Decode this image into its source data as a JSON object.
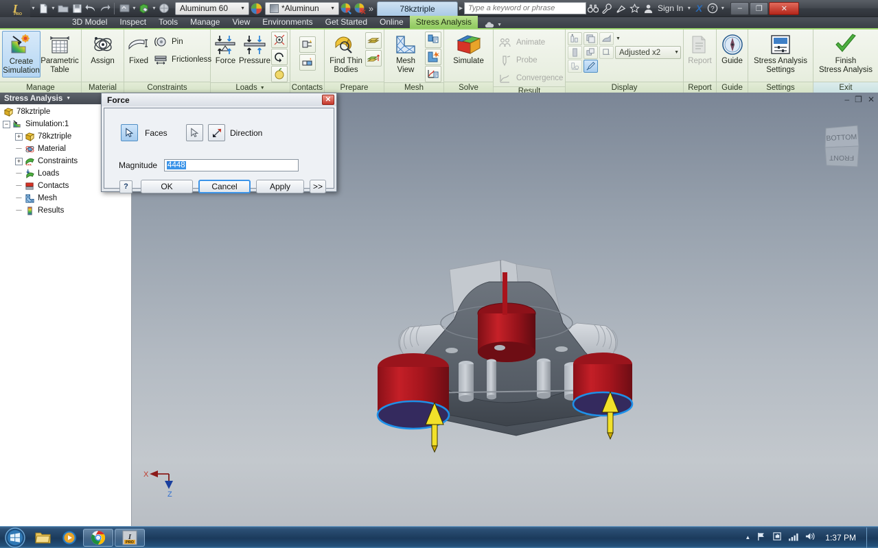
{
  "titlebar": {
    "app_logo": "inventor-logo",
    "pro_badge": "PRO",
    "quick_access": [
      {
        "name": "new-file",
        "icon": "document-icon"
      },
      {
        "name": "open-file",
        "icon": "folder-open-icon"
      },
      {
        "name": "save-file",
        "icon": "floppy-disk-icon"
      },
      {
        "name": "undo",
        "icon": "undo-arrow-icon"
      },
      {
        "name": "redo",
        "icon": "redo-arrow-icon"
      },
      {
        "name": "update",
        "icon": "update-icon"
      },
      {
        "name": "material-swatch",
        "icon": "material-box-icon"
      },
      {
        "name": "select-mode",
        "icon": "select-sphere-icon"
      }
    ],
    "material_combo": "Aluminum 60",
    "appearance_combo": "*Aluminun",
    "document_tab": "78kztriple",
    "search_placeholder": "Type a keyword or phrase",
    "search_value": "",
    "right_icons": [
      {
        "name": "binoculars-icon"
      },
      {
        "name": "wrench-icon"
      },
      {
        "name": "satellite-dish-icon"
      },
      {
        "name": "star-icon"
      }
    ],
    "sign_in": "Sign In",
    "exchange_icon": "autodesk-x-icon",
    "help_icon": "help-question-icon",
    "window_buttons": {
      "minimize": "–",
      "restore": "❐",
      "close": "✕"
    }
  },
  "ribbon_tabs": [
    {
      "label": "3D Model",
      "active": false
    },
    {
      "label": "Inspect",
      "active": false
    },
    {
      "label": "Tools",
      "active": false
    },
    {
      "label": "Manage",
      "active": false
    },
    {
      "label": "View",
      "active": false
    },
    {
      "label": "Environments",
      "active": false
    },
    {
      "label": "Get Started",
      "active": false
    },
    {
      "label": "Online",
      "active": false
    },
    {
      "label": "Stress Analysis",
      "active": true
    }
  ],
  "ribbon_tab_overflow": "cloud-dropdown-icon",
  "ribbon": {
    "panels": [
      {
        "title": "Manage",
        "buttons": [
          {
            "label": "Create\nSimulation",
            "icon": "create-simulation-icon",
            "selected": true
          },
          {
            "label": "Parametric\nTable",
            "icon": "parametric-table-icon",
            "selected": false
          }
        ]
      },
      {
        "title": "Material",
        "buttons": [
          {
            "label": "Assign",
            "icon": "assign-material-icon",
            "selected": false
          }
        ]
      },
      {
        "title": "Constraints",
        "buttons": [
          {
            "label": "Fixed",
            "icon": "fixed-constraint-icon",
            "selected": false
          }
        ],
        "small_items": [
          {
            "label": "Pin",
            "icon": "pin-constraint-icon"
          },
          {
            "label": "Frictionless",
            "icon": "frictionless-constraint-icon"
          }
        ]
      },
      {
        "title": "Loads",
        "has_dropdown": true,
        "buttons": [
          {
            "label": "Force",
            "icon": "force-load-icon",
            "selected": false
          },
          {
            "label": "Pressure",
            "icon": "pressure-load-icon",
            "selected": false
          }
        ],
        "icon_stack": [
          {
            "name": "bearing-load-icon"
          },
          {
            "name": "moment-load-icon"
          },
          {
            "name": "gravity-load-icon"
          }
        ]
      },
      {
        "title": "Contacts",
        "icon_stack": [
          {
            "name": "automatic-contacts-icon"
          },
          {
            "name": "manual-contact-icon"
          }
        ]
      },
      {
        "title": "Prepare",
        "buttons": [
          {
            "label": "Find Thin\nBodies",
            "icon": "find-thin-bodies-icon",
            "selected": false
          }
        ],
        "icon_stack": [
          {
            "name": "midsurface-icon"
          },
          {
            "name": "offset-surface-icon"
          }
        ]
      },
      {
        "title": "Mesh",
        "buttons": [
          {
            "label": "Mesh View",
            "icon": "mesh-view-icon",
            "selected": false
          }
        ],
        "icon_stack": [
          {
            "name": "mesh-settings-icon"
          },
          {
            "name": "local-mesh-control-icon"
          },
          {
            "name": "convergence-settings-icon"
          }
        ]
      },
      {
        "title": "Solve",
        "buttons": [
          {
            "label": "Simulate",
            "icon": "simulate-cube-icon",
            "selected": false
          }
        ]
      },
      {
        "title": "Result",
        "small_items": [
          {
            "label": "Animate",
            "icon": "animate-icon",
            "disabled": true
          },
          {
            "label": "Probe",
            "icon": "probe-icon",
            "disabled": true
          },
          {
            "label": "Convergence",
            "icon": "convergence-icon",
            "disabled": true
          }
        ]
      },
      {
        "title": "Display",
        "adjust_combo": "Adjusted x2",
        "icon_grid": [
          {
            "name": "max-min-values-icon",
            "selected": false
          },
          {
            "name": "boundary-conditions-icon",
            "selected": false
          },
          {
            "name": "shaded-contour-icon",
            "selected": false
          },
          {
            "name": "color-bar-icon",
            "selected": false
          },
          {
            "name": "probe-labels-icon",
            "selected": false
          },
          {
            "name": "display-mesh-icon",
            "selected": false
          },
          {
            "name": "reaction-force-icon",
            "selected": false
          },
          {
            "name": "brush-icon",
            "selected": true
          }
        ]
      },
      {
        "title": "Report",
        "buttons": [
          {
            "label": "Report",
            "icon": "report-icon",
            "disabled": true,
            "selected": false
          }
        ]
      },
      {
        "title": "Guide",
        "buttons": [
          {
            "label": "Guide",
            "icon": "compass-guide-icon",
            "selected": false
          }
        ]
      },
      {
        "title": "Settings",
        "buttons": [
          {
            "label": "Stress Analysis\nSettings",
            "icon": "stress-analysis-settings-icon",
            "selected": false
          }
        ]
      },
      {
        "title": "Exit",
        "buttons": [
          {
            "label": "Finish\nStress Analysis",
            "icon": "green-checkmark-icon",
            "selected": false
          }
        ]
      }
    ]
  },
  "browser": {
    "header": "Stress Analysis",
    "tree": [
      {
        "label": "78kztriple",
        "depth": 0,
        "icon": "part-cube-icon",
        "expander": "none",
        "line": false
      },
      {
        "label": "Simulation:1",
        "depth": 0,
        "icon": "simulation-icon",
        "expander": "minus",
        "line": false
      },
      {
        "label": "78kztriple",
        "depth": 1,
        "icon": "part-cube-icon",
        "expander": "plus",
        "line": false
      },
      {
        "label": "Material",
        "depth": 1,
        "icon": "material-icon",
        "expander": "none",
        "line": true
      },
      {
        "label": "Constraints",
        "depth": 1,
        "icon": "constraints-icon",
        "expander": "plus",
        "line": false
      },
      {
        "label": "Loads",
        "depth": 1,
        "icon": "loads-icon",
        "expander": "none",
        "line": true
      },
      {
        "label": "Contacts",
        "depth": 1,
        "icon": "contacts-icon",
        "expander": "none",
        "line": true
      },
      {
        "label": "Mesh",
        "depth": 1,
        "icon": "mesh-icon",
        "expander": "none",
        "line": true
      },
      {
        "label": "Results",
        "depth": 1,
        "icon": "results-icon",
        "expander": "none",
        "line": true
      }
    ]
  },
  "viewport": {
    "doc_window_buttons": {
      "minimize": "–",
      "restore": "❐",
      "close": "✕"
    },
    "viewcube": {
      "top_face": "BOTTOM",
      "front_face": "FRONT"
    },
    "axis_tripod": {
      "x_label": "X",
      "z_label": "Z"
    },
    "model_name": "78kztriple"
  },
  "force_dialog": {
    "title": "Force",
    "close_glyph": "✕",
    "faces_label": "Faces",
    "faces_button_icon": "cursor-select-icon",
    "direction_label": "Direction",
    "direction_pick_icon": "cursor-select-icon",
    "direction_flip_icon": "flip-direction-icon",
    "magnitude_label": "Magnitude",
    "magnitude_value": "4448",
    "help_glyph": "?",
    "buttons": {
      "ok": "OK",
      "cancel": "Cancel",
      "apply": "Apply",
      "more": ">>"
    }
  },
  "taskbar": {
    "start_button": "windows-start-orb",
    "items": [
      {
        "name": "windows-explorer-icon",
        "open": false
      },
      {
        "name": "media-player-icon",
        "open": false
      },
      {
        "name": "google-chrome-icon",
        "open": true
      },
      {
        "name": "autodesk-inventor-icon",
        "open": true
      }
    ],
    "tray": [
      {
        "name": "show-hidden-icons-arrow"
      },
      {
        "name": "action-center-flag-icon"
      },
      {
        "name": "network-hand-icon"
      },
      {
        "name": "network-signal-icon"
      },
      {
        "name": "volume-speaker-icon"
      }
    ],
    "time": "1:37 PM"
  },
  "colors": {
    "accent_green": "#8fc95f",
    "highlight_blue": "#3a93e8",
    "selected_face_red": "#b61f2a",
    "load_arrow_yellow": "#f2e12a",
    "edge_highlight_blue": "#1e8fe0",
    "close_red": "#b4261a"
  }
}
